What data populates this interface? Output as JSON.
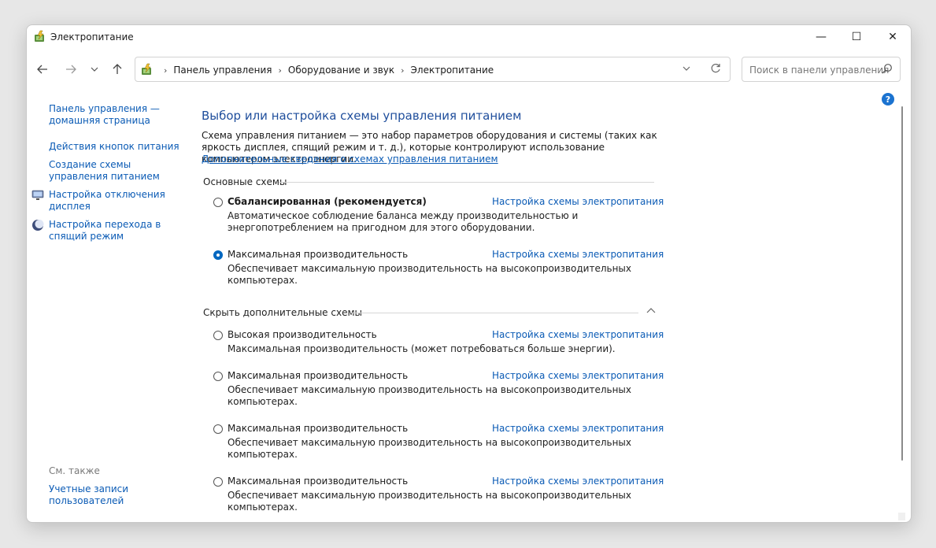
{
  "window": {
    "title": "Электропитание",
    "controls": {
      "minimize": "—",
      "maximize": "☐",
      "close": "✕"
    }
  },
  "nav": {
    "back_icon": "arrow-left-icon",
    "forward_icon": "arrow-right-icon",
    "recent_icon": "chevron-down-icon",
    "up_icon": "arrow-up-icon"
  },
  "address": {
    "crumbs": [
      "Панель управления",
      "Оборудование и звук",
      "Электропитание"
    ]
  },
  "search": {
    "placeholder": "Поиск в панели управления"
  },
  "sidebar": {
    "home_link": "Панель управления — домашняя страница",
    "links": [
      {
        "label": "Действия кнопок питания",
        "icon": ""
      },
      {
        "label": "Создание схемы управления питанием",
        "icon": ""
      },
      {
        "label": "Настройка отключения дисплея",
        "icon": "display-icon"
      },
      {
        "label": "Настройка перехода в спящий режим",
        "icon": "moon-icon"
      }
    ],
    "see_also": "См. также",
    "user_accounts": "Учетные записи пользователей"
  },
  "main": {
    "heading": "Выбор или настройка схемы управления питанием",
    "description": "Схема управления питанием — это набор параметров оборудования и системы (таких как яркость дисплея, спящий режим и т. д.), которые контролируют использование компьютером электроэнергии.",
    "more_link": "Дополнительные сведения о схемах управления питанием",
    "primary_group": "Основные схемы",
    "hidden_group": "Скрыть дополнительные схемы",
    "plan_link_label": "Настройка схемы электропитания",
    "primary_plans": [
      {
        "name": "Сбалансированная (рекомендуется)",
        "description": "Автоматическое соблюдение баланса между производительностью и энергопотреблением на пригодном для этого оборудовании.",
        "selected": false
      },
      {
        "name": "Максимальная производительность",
        "description": "Обеспечивает максимальную производительность на высокопроизводительных компьютерах.",
        "selected": true
      }
    ],
    "extra_plans": [
      {
        "name": "Высокая производительность",
        "description": "Максимальная производительность (может потребоваться больше энергии).",
        "selected": false
      },
      {
        "name": "Максимальная производительность",
        "description": "Обеспечивает максимальную производительность на высокопроизводительных компьютерах.",
        "selected": false
      },
      {
        "name": "Максимальная производительность",
        "description": "Обеспечивает максимальную производительность на высокопроизводительных компьютерах.",
        "selected": false
      },
      {
        "name": "Максимальная производительность",
        "description": "Обеспечивает максимальную производительность на высокопроизводительных компьютерах.",
        "selected": false
      }
    ]
  },
  "help": {
    "label": "?"
  },
  "colors": {
    "link": "#0b5bb5",
    "heading": "#1f4e9c",
    "accent": "#0067c0"
  }
}
